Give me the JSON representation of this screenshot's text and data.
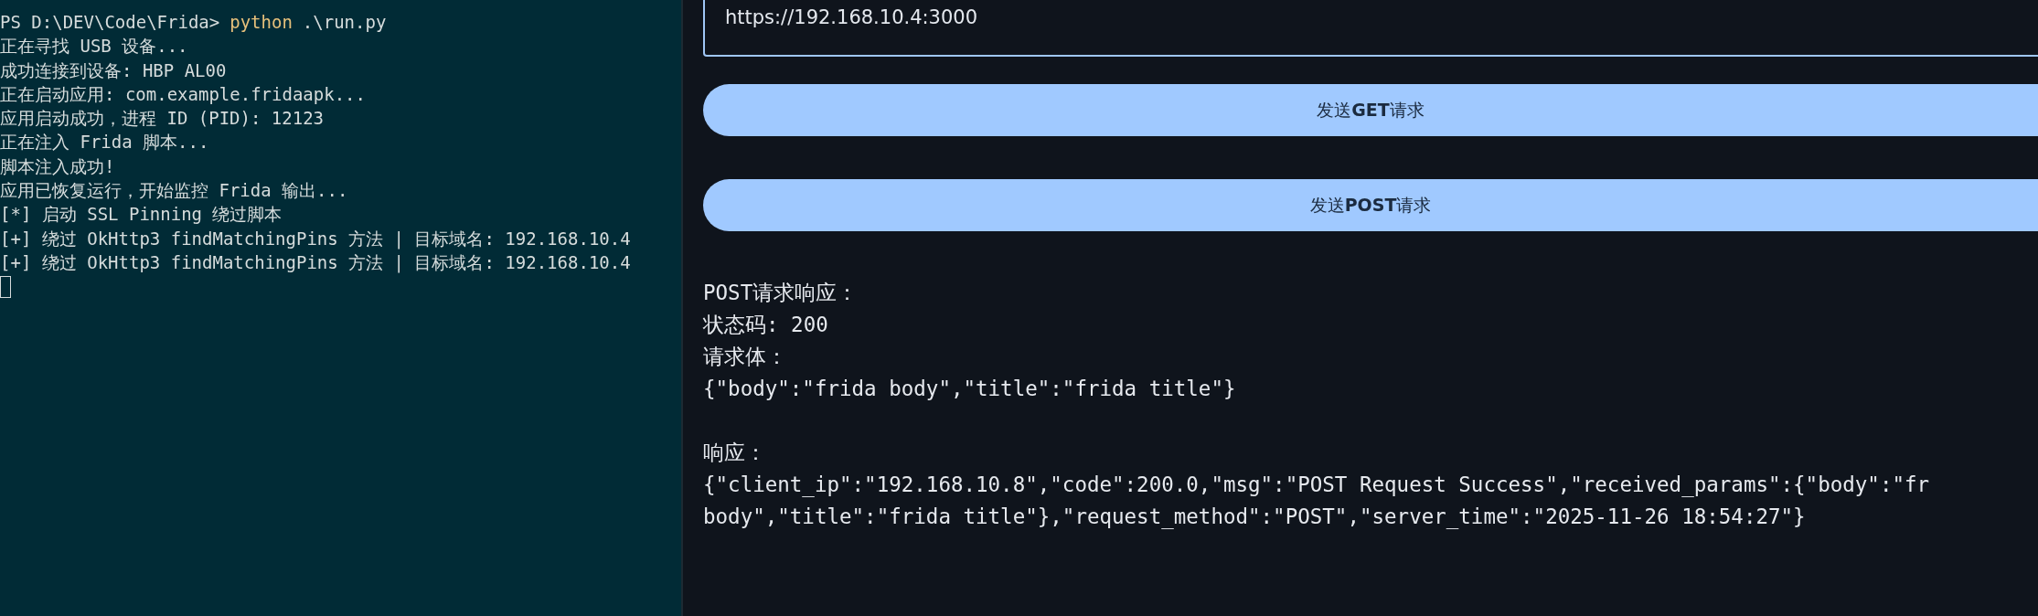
{
  "terminal": {
    "lines": [
      {
        "kind": "prompt",
        "prompt": "PS D:\\DEV\\Code\\Frida>",
        "command": "python",
        "args": ".\\run.py"
      },
      {
        "kind": "output",
        "text": "正在寻找 USB 设备..."
      },
      {
        "kind": "output",
        "text": "成功连接到设备: HBP AL00"
      },
      {
        "kind": "output",
        "text": "正在启动应用: com.example.fridaapk..."
      },
      {
        "kind": "output",
        "text": "应用启动成功，进程 ID (PID): 12123"
      },
      {
        "kind": "output",
        "text": "正在注入 Frida 脚本..."
      },
      {
        "kind": "output",
        "text": "脚本注入成功!"
      },
      {
        "kind": "output",
        "text": "应用已恢复运行，开始监控 Frida 输出..."
      },
      {
        "kind": "output",
        "text": "[*] 启动 SSL Pinning 绕过脚本"
      },
      {
        "kind": "output",
        "text": "[+] 绕过 OkHttp3 findMatchingPins 方法 | 目标域名: 192.168.10.4"
      },
      {
        "kind": "output",
        "text": "[+] 绕过 OkHttp3 findMatchingPins 方法 | 目标域名: 192.168.10.4"
      },
      {
        "kind": "cursor"
      }
    ]
  },
  "app": {
    "url_field": {
      "value": "https://192.168.10.4:3000"
    },
    "buttons": [
      {
        "label": "发送**GET**请求"
      },
      {
        "label": "发送**POST**请求"
      }
    ],
    "response_blocks": [
      [
        "POST请求响应：",
        "状态码: 200",
        "请求体：",
        "{\"body\":\"frida body\",\"title\":\"frida title\"}"
      ],
      [
        "响应：",
        "{\"client_ip\":\"192.168.10.8\",\"code\":200.0,\"msg\":\"POST Request Success\",\"received_params\":{\"body\":\"fr",
        "body\",\"title\":\"frida title\"},\"request_method\":\"POST\",\"server_time\":\"2025-11-26 18:54:27\"}"
      ]
    ]
  }
}
